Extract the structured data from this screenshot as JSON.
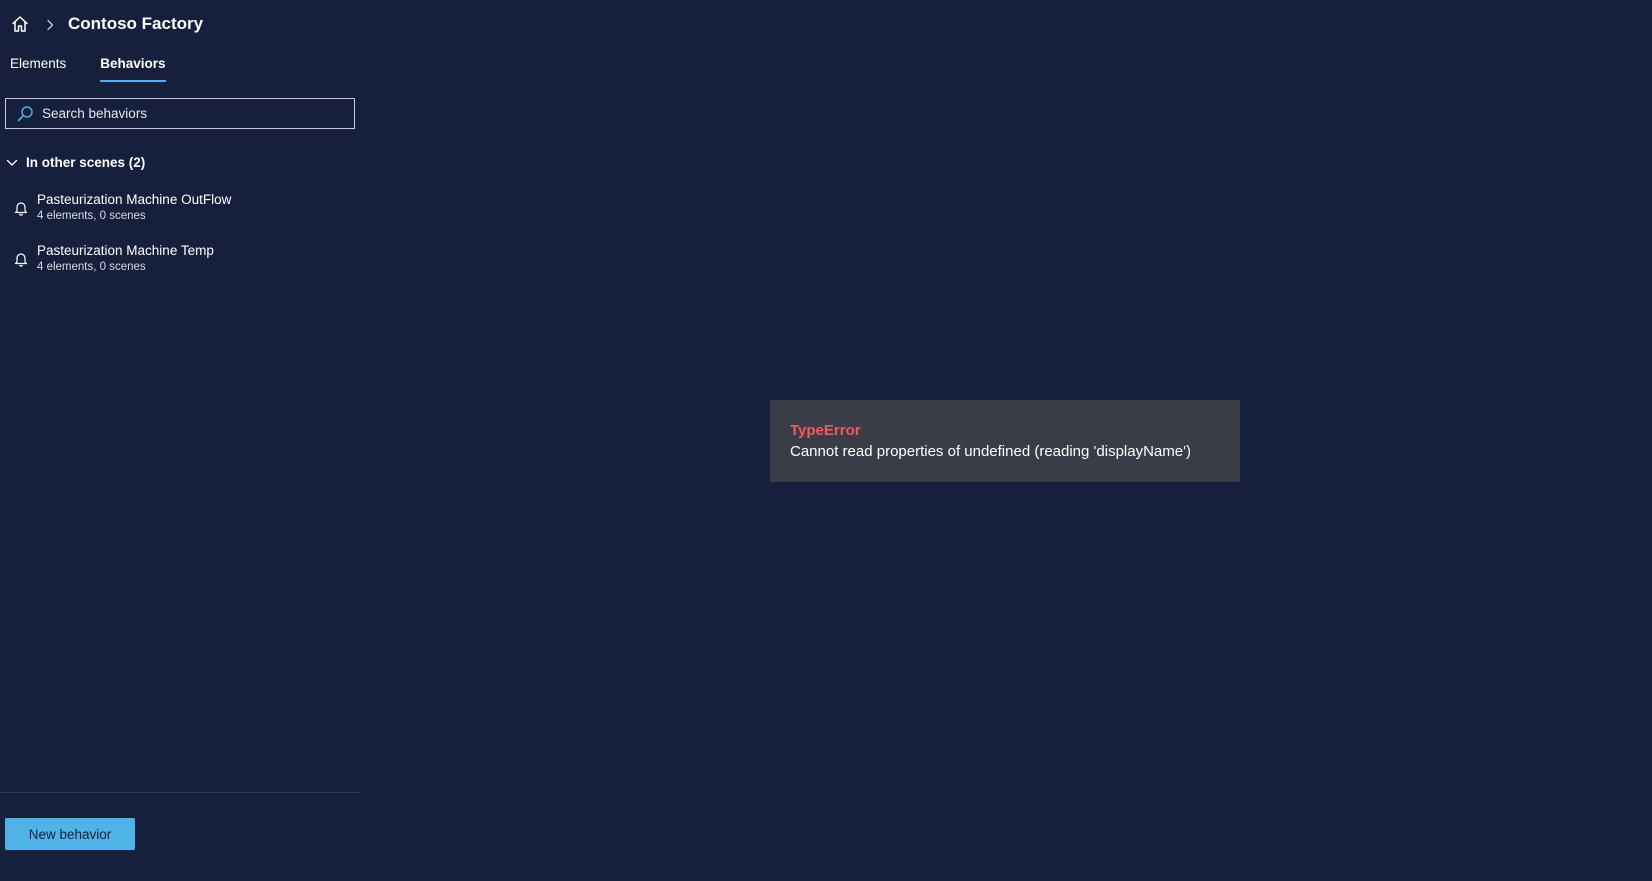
{
  "header": {
    "breadcrumb_title": "Contoso Factory",
    "icons": {
      "home": "home-icon",
      "separator": "chevron-right-icon"
    }
  },
  "tabs": [
    {
      "label": "Elements",
      "active": false
    },
    {
      "label": "Behaviors",
      "active": true
    }
  ],
  "search": {
    "placeholder": "Search behaviors",
    "value": "",
    "icon": "search-icon"
  },
  "group": {
    "label": "In other scenes (2)",
    "expanded": true,
    "icon": "chevron-down-icon",
    "items": [
      {
        "name": "Pasteurization Machine OutFlow",
        "meta": "4 elements, 0 scenes",
        "icon": "bell-icon"
      },
      {
        "name": "Pasteurization Machine Temp",
        "meta": "4 elements, 0 scenes",
        "icon": "bell-icon"
      }
    ]
  },
  "footer": {
    "new_behavior_label": "New behavior"
  },
  "error": {
    "title": "TypeError",
    "message": "Cannot read properties of undefined (reading 'displayName')"
  },
  "colors": {
    "background": "#16203d",
    "accent": "#4fb3e8",
    "error_title": "#f05b5b",
    "error_card": "#3a3d48"
  }
}
